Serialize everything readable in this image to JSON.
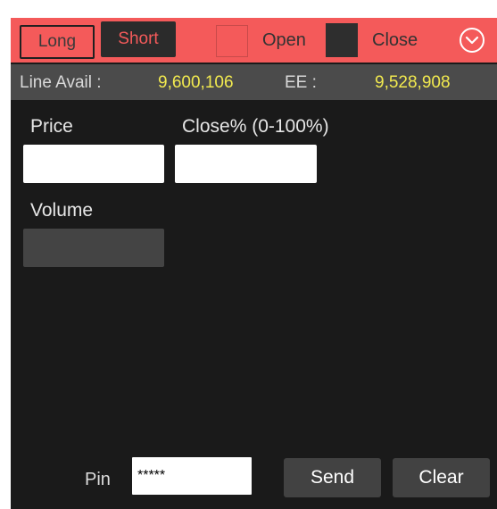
{
  "header": {
    "long_label": "Long",
    "short_label": "Short",
    "open_label": "Open",
    "close_label": "Close",
    "accent_color": "#f45a5a",
    "collapse_icon": "chevron-down-circle-icon"
  },
  "info": {
    "line_avail_label": "Line Avail :",
    "line_avail_value": "9,600,106",
    "ee_label": "EE :",
    "ee_value": "9,528,908",
    "value_color": "#f2ea4f"
  },
  "form": {
    "price_label": "Price",
    "price_value": "",
    "close_pct_label": "Close% (0-100%)",
    "close_pct_value": "",
    "volume_label": "Volume",
    "volume_value": ""
  },
  "footer": {
    "pin_label": "Pin",
    "pin_value": "*****",
    "send_label": "Send",
    "clear_label": "Clear"
  }
}
